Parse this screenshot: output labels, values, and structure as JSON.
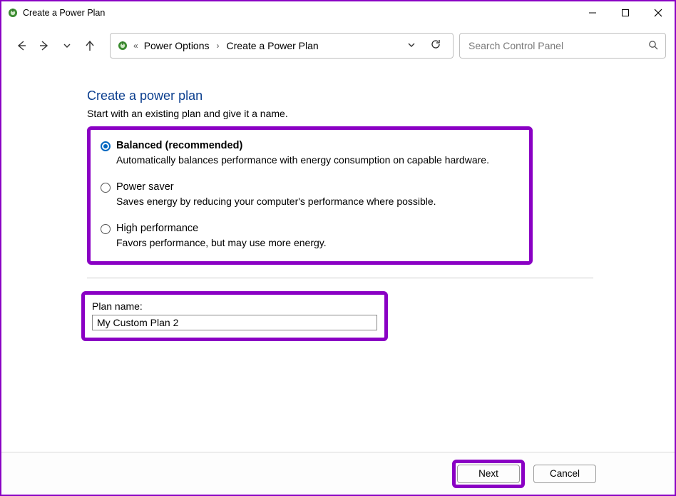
{
  "window": {
    "title": "Create a Power Plan"
  },
  "breadcrumb": {
    "seg1": "Power Options",
    "seg2": "Create a Power Plan"
  },
  "search": {
    "placeholder": "Search Control Panel"
  },
  "page": {
    "title": "Create a power plan",
    "subtitle": "Start with an existing plan and give it a name."
  },
  "plans": [
    {
      "title": "Balanced (recommended)",
      "desc": "Automatically balances performance with energy consumption on capable hardware.",
      "selected": true
    },
    {
      "title": "Power saver",
      "desc": "Saves energy by reducing your computer's performance where possible.",
      "selected": false
    },
    {
      "title": "High performance",
      "desc": "Favors performance, but may use more energy.",
      "selected": false
    }
  ],
  "plan_name": {
    "label": "Plan name:",
    "value": "My Custom Plan 2"
  },
  "buttons": {
    "next": "Next",
    "cancel": "Cancel"
  }
}
